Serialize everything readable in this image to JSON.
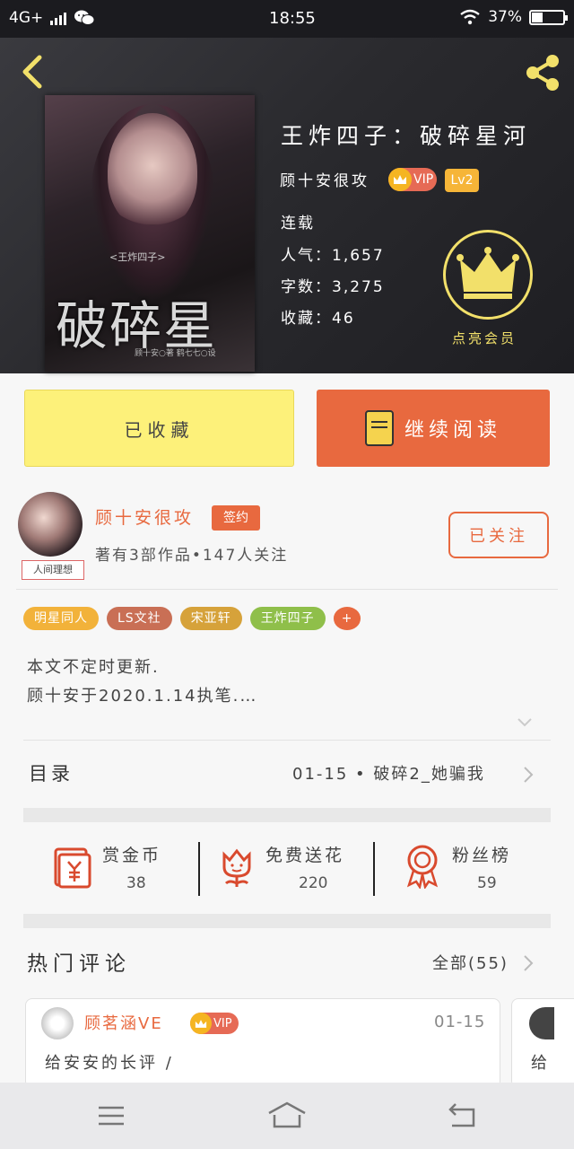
{
  "status_bar": {
    "network": "4G+",
    "time": "18:55",
    "battery": "37%"
  },
  "book": {
    "title": "王炸四子：破碎星河",
    "author": "顾十安很攻",
    "vip": "VIP",
    "level": "Lv2",
    "status": "连载",
    "popularity": "人气：1,657",
    "word_count": "字数：3,275",
    "favorites": "收藏：46",
    "member_label": "点亮会员",
    "cover": {
      "series": "<王炸四子>",
      "title": "破碎星河",
      "credit": "顾十安○著 鹤七七○设"
    }
  },
  "actions": {
    "collected": "已收藏",
    "continue_reading": "继续阅读"
  },
  "author_card": {
    "name": "顾十安很攻",
    "badge": "签约",
    "stats": "著有3部作品•147人关注",
    "follow": "已关注",
    "avatar_tag": "人间理想"
  },
  "tags": [
    {
      "label": "明星同人",
      "color": "#f2b23a"
    },
    {
      "label": "LS文社",
      "color": "#c96f55"
    },
    {
      "label": "宋亚轩",
      "color": "#d6a23a"
    },
    {
      "label": "王炸四子",
      "color": "#8fbf4a"
    },
    {
      "label": "+",
      "color": "#e8693f"
    }
  ],
  "description": [
    "本文不定时更新.",
    "顾十安于2020.1.14执笔.…"
  ],
  "catalog": {
    "label": "目录",
    "latest": "01-15 • 破碎2_她骗我"
  },
  "stats": [
    {
      "label": "赏金币",
      "value": "38",
      "icon": "red-envelope-icon"
    },
    {
      "label": "免费送花",
      "value": "220",
      "icon": "flower-icon"
    },
    {
      "label": "粉丝榜",
      "value": "59",
      "icon": "medal-icon"
    }
  ],
  "comments": {
    "heading": "热门评论",
    "all": "全部(55)",
    "items": [
      {
        "user": "顾茗涵VE",
        "vip": "VIP",
        "date": "01-15",
        "text": "给安安的长评 /"
      },
      {
        "text": "给"
      }
    ]
  },
  "colors": {
    "accent": "#e8693f",
    "yellow": "#fdf17a",
    "gold": "#f2e06a",
    "dark_header": "#2a2a2e"
  }
}
